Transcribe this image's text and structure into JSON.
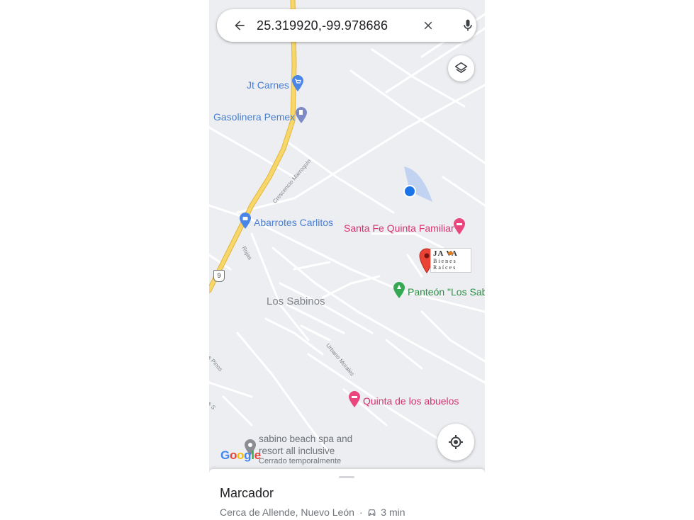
{
  "search": {
    "query": "25.319920,-99.978686"
  },
  "places": {
    "jt_carnes": "Jt Carnes",
    "gasolinera": "Gasolinera Pemex",
    "abarrotes": "Abarrotes Carlitos",
    "santa_fe": "Santa Fe Quinta Familiar",
    "panteon": "Panteón \"Los Sabinos\"",
    "quinta_abuelos": "Quinta de los abuelos",
    "sabino_line1": "sabino beach spa and",
    "sabino_line2": "resort all inclusive",
    "sabino_status": "Cerrado temporalmente"
  },
  "town": "Los Sabinos",
  "streets": {
    "crescencio": "Crescencio Marroquín",
    "rojas": "Rojas",
    "urbano": "Urbano Morales",
    "pinos": "os Pinos",
    "s": "os S"
  },
  "highway_shield": "9",
  "logo_card": {
    "line1": "JA VA",
    "line2": "B i e n e s",
    "line3": "R a í c e s"
  },
  "google_logo": [
    "G",
    "o",
    "o",
    "g",
    "l",
    "e"
  ],
  "sheet": {
    "title": "Marcador",
    "location": "Cerca de Allende, Nuevo León",
    "separator": "·",
    "drive_time": "3 min"
  },
  "icons": {
    "back": "arrow-left-icon",
    "clear": "close-icon",
    "mic": "microphone-icon",
    "layers": "layers-icon",
    "locate": "my-location-icon",
    "car": "car-icon"
  },
  "colors": {
    "highway": "#f5cf55",
    "road": "#ffffff",
    "map_bg": "#eceef1",
    "location_dot": "#1a73e8",
    "marker_red": "#ea4335"
  }
}
